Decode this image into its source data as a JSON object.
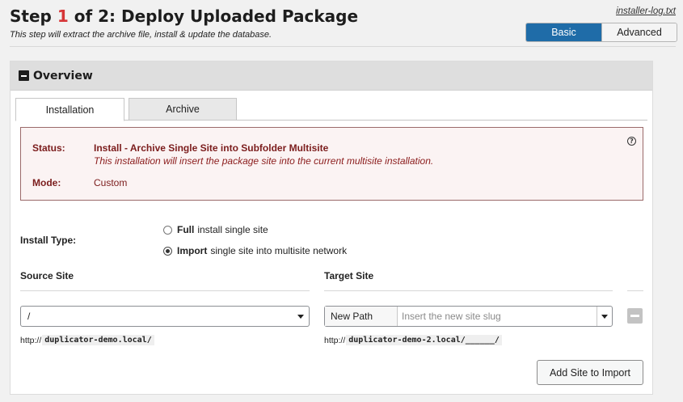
{
  "header": {
    "title_prefix": "Step ",
    "step_current": "1",
    "title_suffix": " of 2: Deploy Uploaded Package",
    "subtitle": "This step will extract the archive file, install & update the database.",
    "log_link": "installer-log.txt"
  },
  "mode_toggle": {
    "basic": "Basic",
    "advanced": "Advanced",
    "selected": "Basic",
    "accent_color": "#1f6ca8"
  },
  "overview": {
    "title": "Overview",
    "tabs": [
      {
        "label": "Installation",
        "active": true
      },
      {
        "label": "Archive",
        "active": false
      }
    ],
    "status": {
      "status_label": "Status:",
      "status_value": "Install - Archive Single Site into Subfolder Multisite",
      "status_note": "This installation will insert the package site into the current multisite installation.",
      "mode_label": "Mode:",
      "mode_value": "Custom",
      "help_icon": "question-circle-icon",
      "text_color": "#7b1c1c"
    },
    "install_type": {
      "label": "Install Type:",
      "options": [
        {
          "bold": "Full",
          "text": "install single site",
          "checked": false
        },
        {
          "bold": "Import",
          "text": "single site into multisite network",
          "checked": true
        }
      ]
    },
    "source_site": {
      "header": "Source Site",
      "selected": "/",
      "url_prefix": "http://",
      "url_slug": "duplicator-demo.local/"
    },
    "target_site": {
      "header": "Target Site",
      "type": "New Path",
      "slug_placeholder": "Insert the new site slug",
      "url_prefix": "http://",
      "url_slug": "duplicator-demo-2.local/______/"
    },
    "add_button": "Add Site to Import"
  }
}
